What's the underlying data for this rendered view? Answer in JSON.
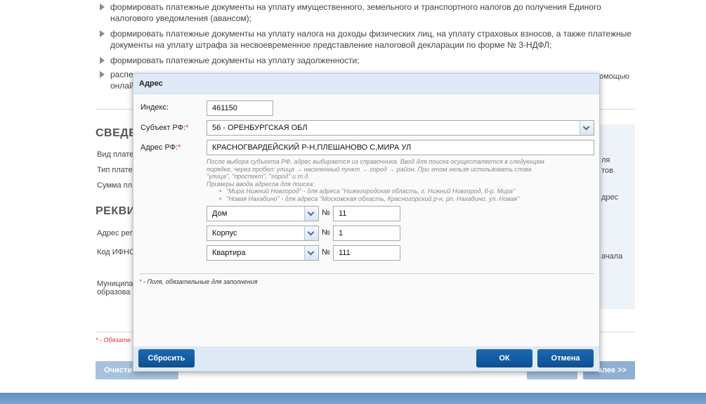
{
  "background": {
    "bullets": [
      "формировать платежные документы на уплату имущественного, земельного и транспортного налогов до получения Единого налогового уведомления (авансом);",
      "формировать платежные документы на уплату налога на доходы физических лиц, на уплату страховых взносов, а также платежные документы на уплату штрафа за несвоевременное представление налоговой декларации по форме № 3-НДФЛ;",
      "формировать платежные документы на уплату задолженности;",
      "распе",
      "онлай"
    ],
    "bullet4_tail": "омощью",
    "section1": "СВЕДЕН",
    "fields1": [
      "Вид плате",
      "Тип плате",
      "Сумма пл"
    ],
    "section2": "РЕКВИЗ",
    "fields2": [
      "Адрес рег",
      "Код ИФНС"
    ],
    "field_municipal": [
      "Муниципа",
      "образова"
    ],
    "right_texts": [
      "ля",
      "тов",
      "дрес",
      "ачала"
    ],
    "required_note": "- Обязате",
    "btn_clear": "Очисти",
    "btn_next": "алее >>"
  },
  "dialog": {
    "title": "Адрес",
    "index_label": "Индекс:",
    "index_value": "461150",
    "subject_label": "Субъект РФ:",
    "subject_value": "56 - ОРЕНБУРГСКАЯ ОБЛ",
    "address_label": "Адрес РФ:",
    "address_value": "КРАСНОГВАРДЕЙСКИЙ Р-Н,ПЛЕШАНОВО С,МИРА УЛ",
    "hint_lines": [
      "После выбора субъекта РФ, адрес выбирается из справочника. Ввод для поиска осуществляется в следующем",
      "порядке, через пробел: улица → населенный пункт → город → район. При этом нельзя использовать слова",
      "\"улица\", \"проспект\", \"город\" и т.д.",
      "Примеры ввода адресов для поиска:"
    ],
    "hint_examples": [
      "\"Мира Нижний Новгород\" - для адреса \"Нижегородская область, г. Нижний Новгород, б-р. Мира\"",
      "\"Новая Нахабино\" - для адреса \"Московская область, Красногорский р-н, рп. Нахабино, ул. Новая\""
    ],
    "rows": [
      {
        "type": "Дом",
        "no_label": "№",
        "value": "11"
      },
      {
        "type": "Корпус",
        "no_label": "№",
        "value": "1"
      },
      {
        "type": "Квартира",
        "no_label": "№",
        "value": "111"
      }
    ],
    "required_note": "- Поля, обязательные для заполнения",
    "star": "*",
    "btn_reset": "Сбросить",
    "btn_ok": "ОК",
    "btn_cancel": "Отмена"
  }
}
